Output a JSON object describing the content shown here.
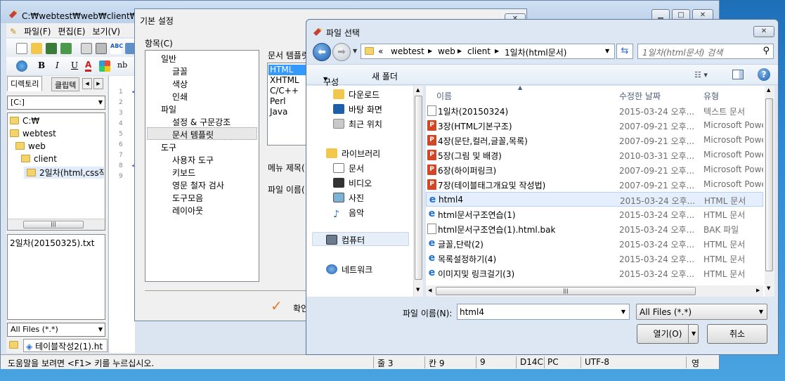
{
  "editor": {
    "title": "C:₩webtest₩web₩client₩2일ג",
    "menu": [
      "파일(F)",
      "편집(E)",
      "보기(V)"
    ],
    "format_buttons": [
      "B",
      "I",
      "U",
      "A",
      "nb"
    ],
    "left_tabs": [
      "디렉토리",
      "클립텍"
    ],
    "drive": "[C:]",
    "tree": [
      "C:₩",
      "webtest",
      "web",
      "client",
      "2일차(html,css작성"
    ],
    "file_list": [
      "2일차(20150325).txt"
    ],
    "filter": "All Files (*.*)",
    "open_tab": "테이블작성2(1).ht",
    "line_numbers": [
      "1",
      "2",
      "3",
      "4",
      "5",
      "6",
      "7",
      "8",
      "9"
    ]
  },
  "status": {
    "help": "도움말을 보려면 <F1> 키를 누르십시오.",
    "line": "줄 3",
    "col": "칸 9",
    "num": "9",
    "code": "D14C",
    "os": "PC",
    "enc": "UTF-8",
    "ime": "영"
  },
  "settings": {
    "title": "기본 설정",
    "category_label": "항목(C)",
    "items": [
      {
        "label": "일반",
        "level": 0
      },
      {
        "label": "글꼴",
        "level": 1
      },
      {
        "label": "색상",
        "level": 1
      },
      {
        "label": "인쇄",
        "level": 1
      },
      {
        "label": "파일",
        "level": 0
      },
      {
        "label": "설정 & 구문강조",
        "level": 1
      },
      {
        "label": "문서 템플릿",
        "level": 1,
        "selected": true
      },
      {
        "label": "도구",
        "level": 0
      },
      {
        "label": "사용자 도구",
        "level": 1
      },
      {
        "label": "키보드",
        "level": 1
      },
      {
        "label": "영문 철자 검사",
        "level": 1
      },
      {
        "label": "도구모음",
        "level": 1
      },
      {
        "label": "레이아웃",
        "level": 1
      }
    ],
    "template_label": "문서 템플릿",
    "templates": [
      "HTML",
      "XHTML",
      "C/C++",
      "Perl",
      "Java"
    ],
    "menu_title_label": "메뉴 제목(",
    "file_name_label": "파일 이름(",
    "ok_label": "확인"
  },
  "file_dialog": {
    "title": "파일 선택",
    "breadcrumb": [
      "webtest",
      "web",
      "client",
      "1일차(html문서)"
    ],
    "search_placeholder": "1일차(html문서) 검색",
    "organize": "구성",
    "new_folder": "새 폴더",
    "nav": {
      "favorites": [
        "다운로드",
        "바탕 화면",
        "최근 위치"
      ],
      "libraries_label": "라이브러리",
      "libraries": [
        "문서",
        "비디오",
        "사진",
        "음악"
      ],
      "computer": "컴퓨터",
      "network": "네트워크"
    },
    "columns": [
      "이름",
      "수정한 날짜",
      "유형"
    ],
    "files": [
      {
        "name": "1일차(20150324)",
        "date": "2015-03-24 오후...",
        "type": "텍스트 문서",
        "icon": "txt"
      },
      {
        "name": "3장(HTML기본구조)",
        "date": "2007-09-21 오후...",
        "type": "Microsoft PowerP",
        "icon": "ppt"
      },
      {
        "name": "4장(문단,컬러,글꼴,목록)",
        "date": "2007-09-21 오후...",
        "type": "Microsoft PowerP",
        "icon": "ppt"
      },
      {
        "name": "5장(그림 및 배경)",
        "date": "2010-03-31 오후...",
        "type": "Microsoft PowerP",
        "icon": "ppt"
      },
      {
        "name": "6장(하이퍼링크)",
        "date": "2007-09-21 오후...",
        "type": "Microsoft PowerP",
        "icon": "ppt"
      },
      {
        "name": "7장(테이블태그개요및 작성법)",
        "date": "2007-09-21 오후...",
        "type": "Microsoft PowerP",
        "icon": "ppt"
      },
      {
        "name": "html4",
        "date": "2015-03-24 오후...",
        "type": "HTML 문서",
        "icon": "ie",
        "selected": true
      },
      {
        "name": "html문서구조연습(1)",
        "date": "2015-03-24 오후...",
        "type": "HTML 문서",
        "icon": "ie"
      },
      {
        "name": "html문서구조연습(1).html.bak",
        "date": "2015-03-24 오후...",
        "type": "BAK 파일",
        "icon": "txt"
      },
      {
        "name": "글꼴,단락(2)",
        "date": "2015-03-24 오후...",
        "type": "HTML 문서",
        "icon": "ie"
      },
      {
        "name": "목록설정하기(4)",
        "date": "2015-03-24 오후...",
        "type": "HTML 문서",
        "icon": "ie"
      },
      {
        "name": "이미지및 링크걸기(3)",
        "date": "2015-03-24 오후...",
        "type": "HTML 문서",
        "icon": "ie"
      }
    ],
    "filename_label": "파일 이름(N):",
    "filename_value": "html4",
    "filter_value": "All Files (*.*)",
    "open_label": "열기(O)",
    "cancel_label": "취소"
  }
}
